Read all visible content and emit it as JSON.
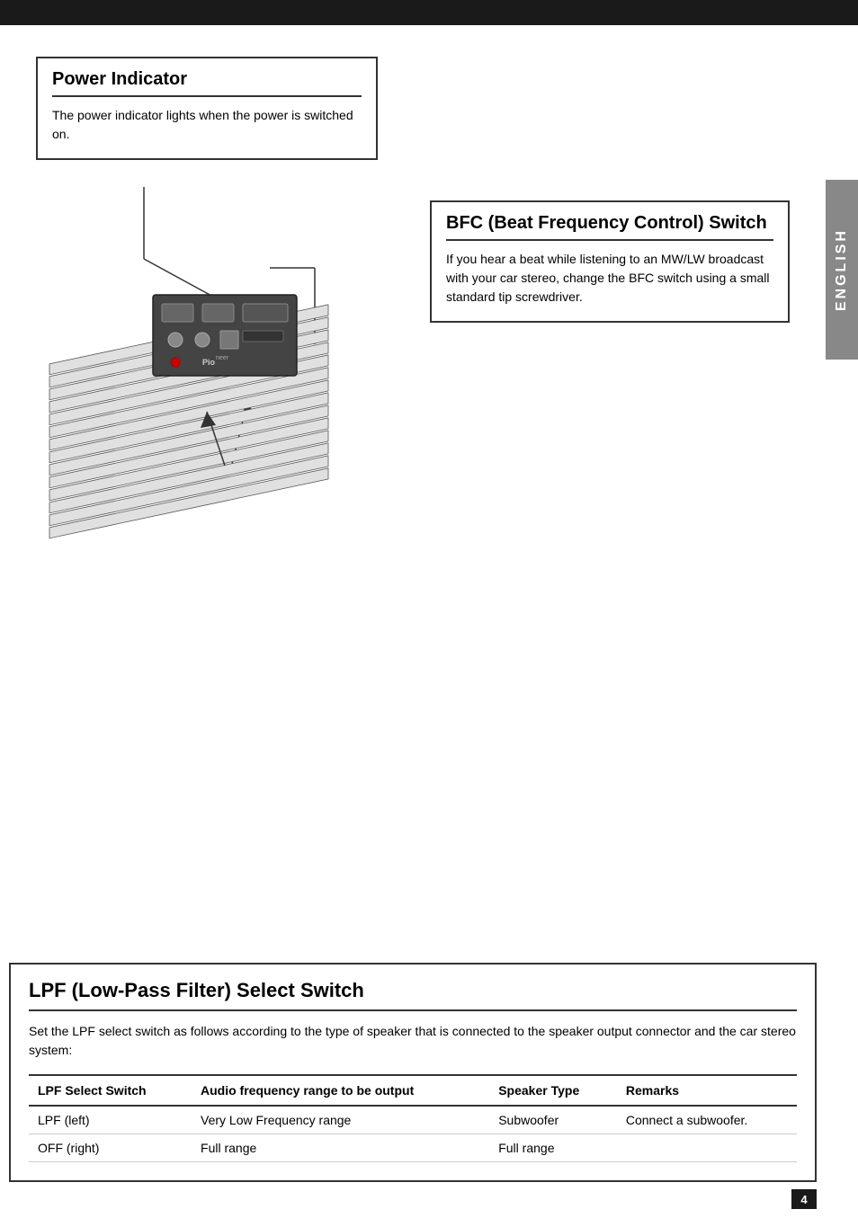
{
  "top_bar": {
    "background": "#1a1a1a"
  },
  "side_tab": {
    "label": "ENGLISH"
  },
  "power_indicator": {
    "title": "Power Indicator",
    "body": "The power indicator lights when the power is switched on."
  },
  "bfc_switch": {
    "title": "BFC (Beat Frequency Control) Switch",
    "body": "If you hear a beat while listening to an MW/LW broadcast with your car stereo, change the BFC switch using a small standard tip screwdriver."
  },
  "lpf_section": {
    "title": "LPF (Low-Pass Filter) Select Switch",
    "description": "Set the LPF select switch as follows according to the type of speaker that is connected to the speaker output connector and the car stereo system:",
    "table": {
      "headers": [
        "LPF Select Switch",
        "Audio frequency range to be output",
        "Speaker Type",
        "Remarks"
      ],
      "rows": [
        [
          "LPF (left)",
          "Very Low Frequency range",
          "Subwoofer",
          "Connect a subwoofer."
        ],
        [
          "OFF (right)",
          "Full range",
          "Full range",
          ""
        ]
      ]
    }
  },
  "page": {
    "number": "4"
  }
}
